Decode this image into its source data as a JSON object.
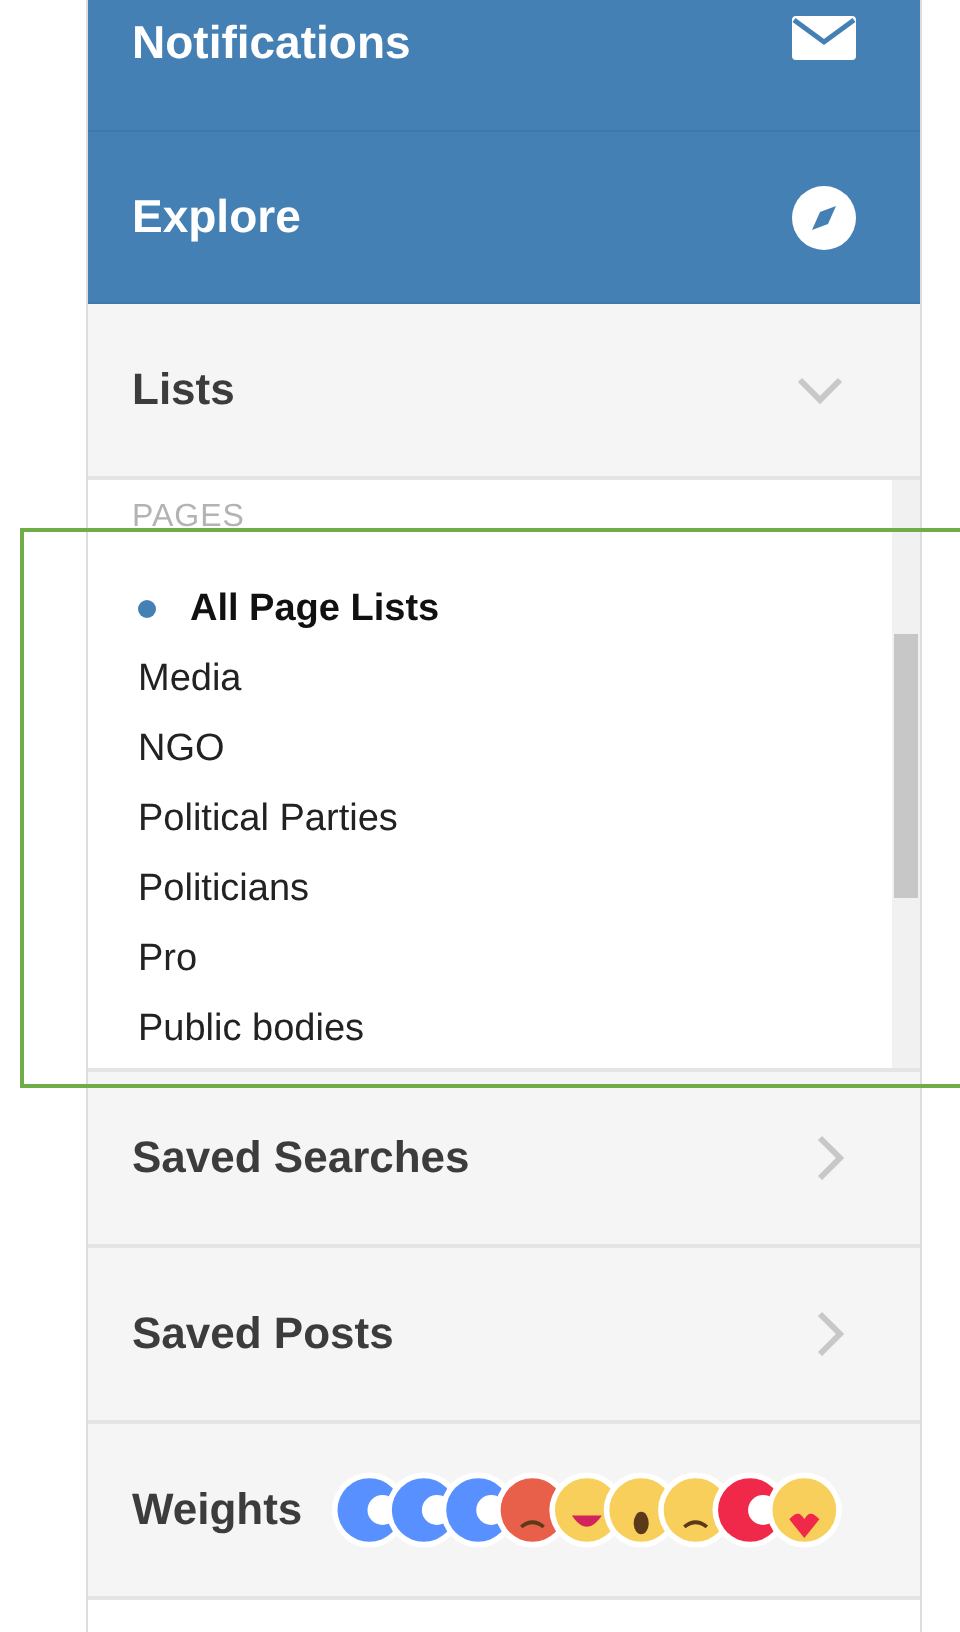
{
  "sections": [
    {
      "kind": "nav",
      "label": "Notifications"
    },
    {
      "kind": "nav",
      "label": "Explore"
    },
    {
      "kind": "collapsible",
      "label": "Lists",
      "expanded": true,
      "group_label": "PAGES",
      "items": [
        {
          "label": "All Page Lists",
          "selected": true
        },
        {
          "label": "Media",
          "selected": false
        },
        {
          "label": "NGO",
          "selected": false
        },
        {
          "label": "Political Parties",
          "selected": false
        },
        {
          "label": "Politicians",
          "selected": false
        },
        {
          "label": "Pro",
          "selected": false
        },
        {
          "label": "Public bodies",
          "selected": false
        }
      ]
    },
    {
      "kind": "collapsible",
      "label": "Saved Searches",
      "expanded": false
    },
    {
      "kind": "collapsible",
      "label": "Saved Posts",
      "expanded": false
    },
    {
      "kind": "reactions",
      "label": "Weights"
    }
  ]
}
